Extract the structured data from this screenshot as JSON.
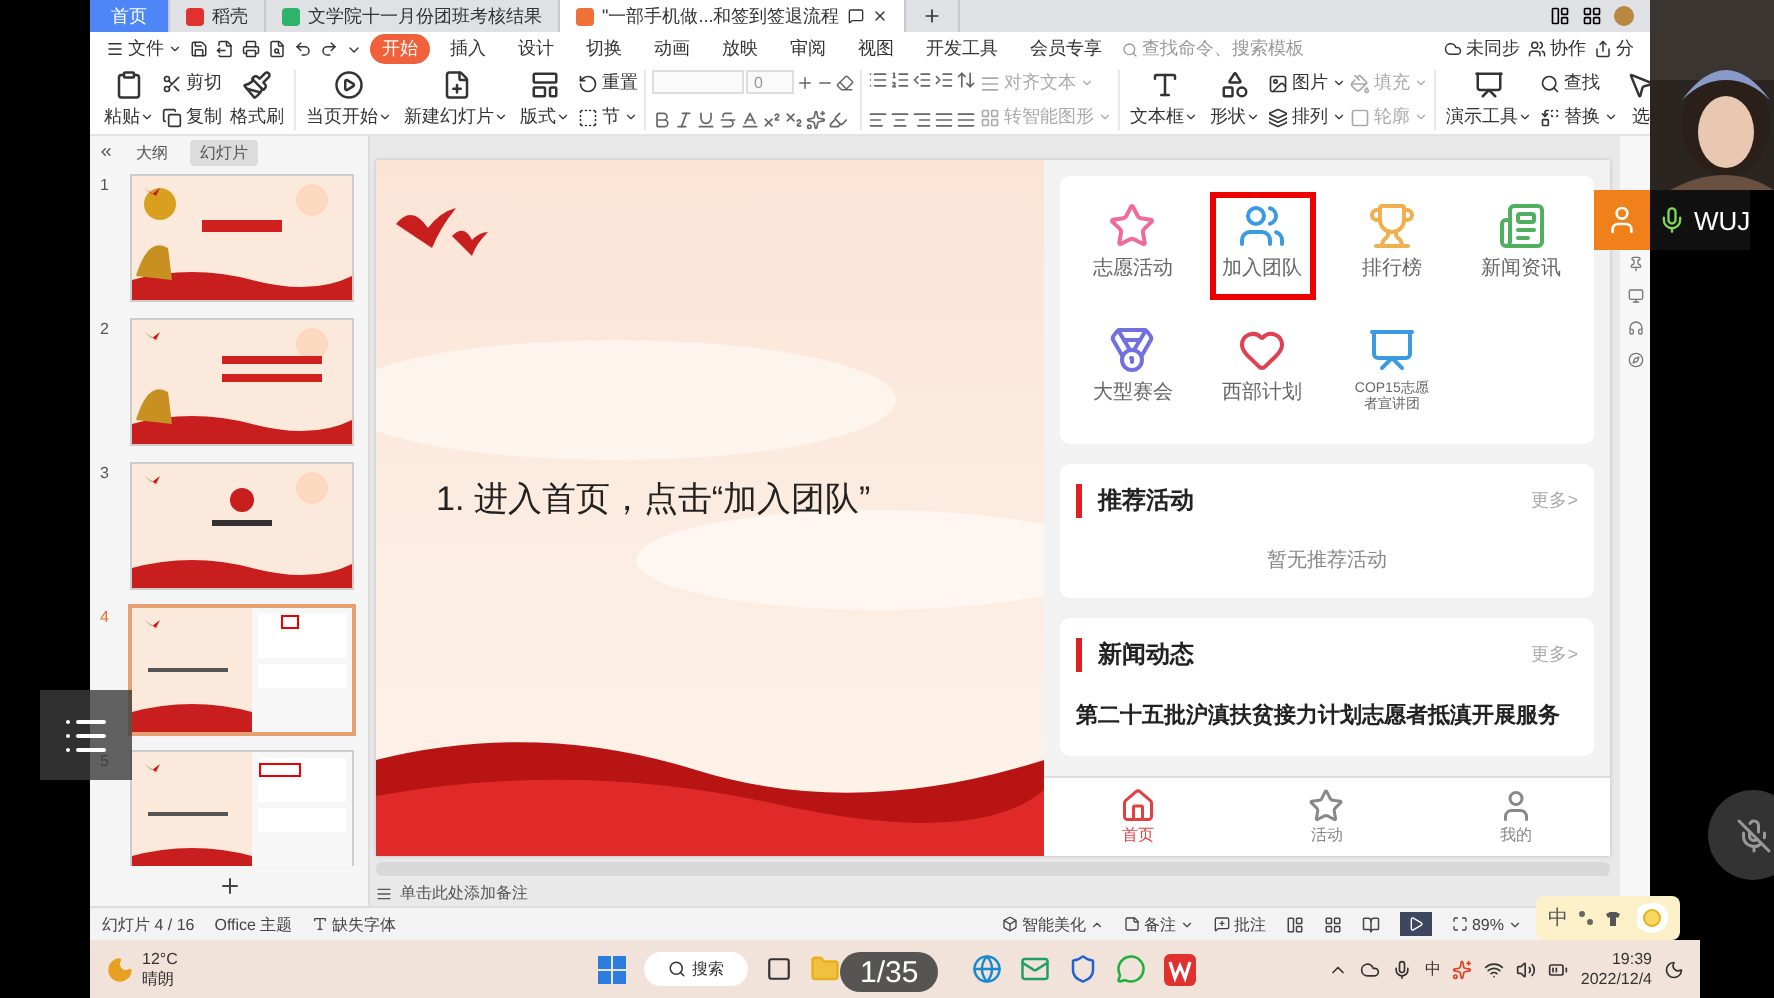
{
  "browser_tabs": [
    {
      "label": "首页",
      "selected": false,
      "kind": "home"
    },
    {
      "label": "稻壳",
      "selected": false,
      "kind": "docer"
    },
    {
      "label": "文学院十一月份团班考核结果",
      "selected": false,
      "kind": "sheet"
    },
    {
      "label": "\"一部手机做...和签到签退流程",
      "selected": true,
      "kind": "slides"
    }
  ],
  "menu": {
    "file": "文件",
    "tabs": [
      {
        "label": "开始",
        "selected": true
      },
      {
        "label": "插入",
        "selected": false
      },
      {
        "label": "设计",
        "selected": false
      },
      {
        "label": "切换",
        "selected": false
      },
      {
        "label": "动画",
        "selected": false
      },
      {
        "label": "放映",
        "selected": false
      },
      {
        "label": "审阅",
        "selected": false
      },
      {
        "label": "视图",
        "selected": false
      },
      {
        "label": "开发工具",
        "selected": false
      },
      {
        "label": "会员专享",
        "selected": false
      }
    ],
    "search_placeholder": "查找命令、搜索模板",
    "actions": [
      "未同步",
      "协作",
      "分"
    ]
  },
  "ribbon_groups": [
    [
      {
        "kind": "big",
        "label": "粘贴",
        "dropdown": true,
        "disabled": false
      },
      {
        "kind": "stack",
        "items": [
          {
            "label": "剪切",
            "dropdown": false,
            "disabled": false
          },
          {
            "label": "复制",
            "dropdown": false,
            "disabled": false
          }
        ]
      },
      {
        "kind": "big",
        "label": "格式刷",
        "dropdown": false,
        "disabled": false
      }
    ],
    [
      {
        "kind": "big",
        "label": "当页开始",
        "dropdown": true,
        "disabled": false
      },
      {
        "kind": "big",
        "label": "新建幻灯片",
        "dropdown": true,
        "disabled": false
      },
      {
        "kind": "big",
        "label": "版式",
        "dropdown": true,
        "disabled": false
      },
      {
        "kind": "stack",
        "items": [
          {
            "label": "重置",
            "dropdown": false,
            "disabled": false
          },
          {
            "label": "节",
            "dropdown": true,
            "disabled": false
          }
        ]
      }
    ],
    [
      {
        "kind": "font",
        "size": "0"
      }
    ],
    [
      {
        "kind": "paragraph"
      },
      {
        "kind": "stack",
        "items": [
          {
            "label": "对齐文本",
            "dropdown": true,
            "disabled": true
          },
          {
            "label": "转智能图形",
            "dropdown": true,
            "disabled": true
          }
        ]
      }
    ],
    [
      {
        "kind": "big",
        "label": "文本框",
        "dropdown": true,
        "disabled": false
      },
      {
        "kind": "big",
        "label": "形状",
        "dropdown": true,
        "disabled": false
      },
      {
        "kind": "stack",
        "items": [
          {
            "label": "图片",
            "dropdown": true,
            "disabled": false
          },
          {
            "label": "排列",
            "dropdown": true,
            "disabled": false
          }
        ]
      },
      {
        "kind": "stack",
        "items": [
          {
            "label": "填充",
            "dropdown": true,
            "disabled": true
          },
          {
            "label": "轮廓",
            "dropdown": true,
            "disabled": true
          }
        ]
      }
    ],
    [
      {
        "kind": "big",
        "label": "演示工具",
        "dropdown": true,
        "disabled": false
      },
      {
        "kind": "stack",
        "items": [
          {
            "label": "查找",
            "dropdown": false,
            "disabled": false
          },
          {
            "label": "替换",
            "dropdown": true,
            "disabled": false
          }
        ]
      },
      {
        "kind": "big",
        "label": "选",
        "dropdown": false,
        "disabled": false
      }
    ]
  ],
  "slide_panel": {
    "tabs": [
      {
        "label": "大纲",
        "selected": false
      },
      {
        "label": "幻灯片",
        "selected": true
      }
    ],
    "slides": [
      {
        "number": "1",
        "selected": false
      },
      {
        "number": "2",
        "selected": false
      },
      {
        "number": "3",
        "selected": false
      },
      {
        "number": "4",
        "selected": true
      },
      {
        "number": "5",
        "selected": false
      }
    ]
  },
  "slide": {
    "instruction": "1. 进入首页，点击“加入团队”",
    "features": [
      {
        "label": "志愿活动",
        "highlighted": false
      },
      {
        "label": "加入团队",
        "highlighted": true
      },
      {
        "label": "排行榜",
        "highlighted": false
      },
      {
        "label": "新闻资讯",
        "highlighted": false
      },
      {
        "label": "大型赛会",
        "highlighted": false
      },
      {
        "label": "西部计划",
        "highlighted": false
      },
      {
        "label": "COP15志愿者宣讲团",
        "highlighted": false
      }
    ],
    "sections": [
      {
        "title": "推荐活动",
        "more": "更多>",
        "body": "暂无推荐活动",
        "kind": "empty"
      },
      {
        "title": "新闻动态",
        "more": "更多>",
        "body": "第二十五批沪滇扶贫接力计划志愿者抵滇开展服务",
        "kind": "news"
      }
    ],
    "nav": [
      {
        "label": "首页",
        "selected": true
      },
      {
        "label": "活动",
        "selected": false
      },
      {
        "label": "我的",
        "selected": false
      }
    ]
  },
  "notes_placeholder": "单击此处添加备注",
  "status_bar": {
    "slide_count": "幻灯片 4 / 16",
    "theme": "Office 主题",
    "missing_font": "缺失字体",
    "beautify": "智能美化",
    "notes": "备注",
    "comments": "批注",
    "zoom": "89%"
  },
  "taskbar": {
    "temperature": "12°C",
    "weather": "晴朗",
    "search": "搜索",
    "page_counter": "1/35",
    "ime": "中",
    "time": "19:39",
    "date": "2022/12/4"
  },
  "ime_bar": {
    "mode": "中"
  },
  "video": {
    "name": "WUJ"
  }
}
